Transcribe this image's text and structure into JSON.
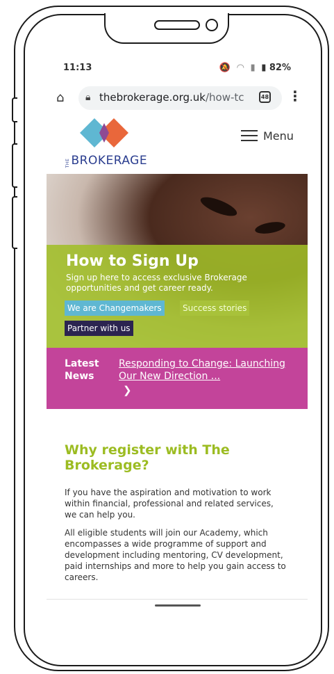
{
  "status_bar": {
    "time": "11:13",
    "battery": "82%"
  },
  "browser": {
    "url_host": "thebrokerage.org.uk",
    "url_path": "/how-tc",
    "tab_count": "48"
  },
  "site": {
    "logo_the": "THE",
    "logo_name": "BROKERAGE",
    "menu_label": "Menu",
    "brand_colors": {
      "teal": "#5fb7d2",
      "orange": "#e9673b",
      "purple": "#8e4a93",
      "green": "#9cbc22",
      "magenta": "#c3449a"
    }
  },
  "hero": {
    "title": "How to Sign Up",
    "subtitle": "Sign up here to access exclusive Brokerage opportunities and get career ready.",
    "tags": [
      "We are Changemakers",
      "Success stories",
      "Partner with us"
    ]
  },
  "news": {
    "label": "Latest News",
    "headline": "Responding to Change: Launching Our New Direction ..."
  },
  "main": {
    "heading": "Why register with The Brokerage?",
    "paragraph1": "If you have the aspiration and motivation to work within financial, professional and related services, we can help you.",
    "paragraph2": "All eligible students will join our Academy, which encompasses a wide programme of support and development including  mentoring, CV development, paid internships and more to help you gain access to careers."
  }
}
